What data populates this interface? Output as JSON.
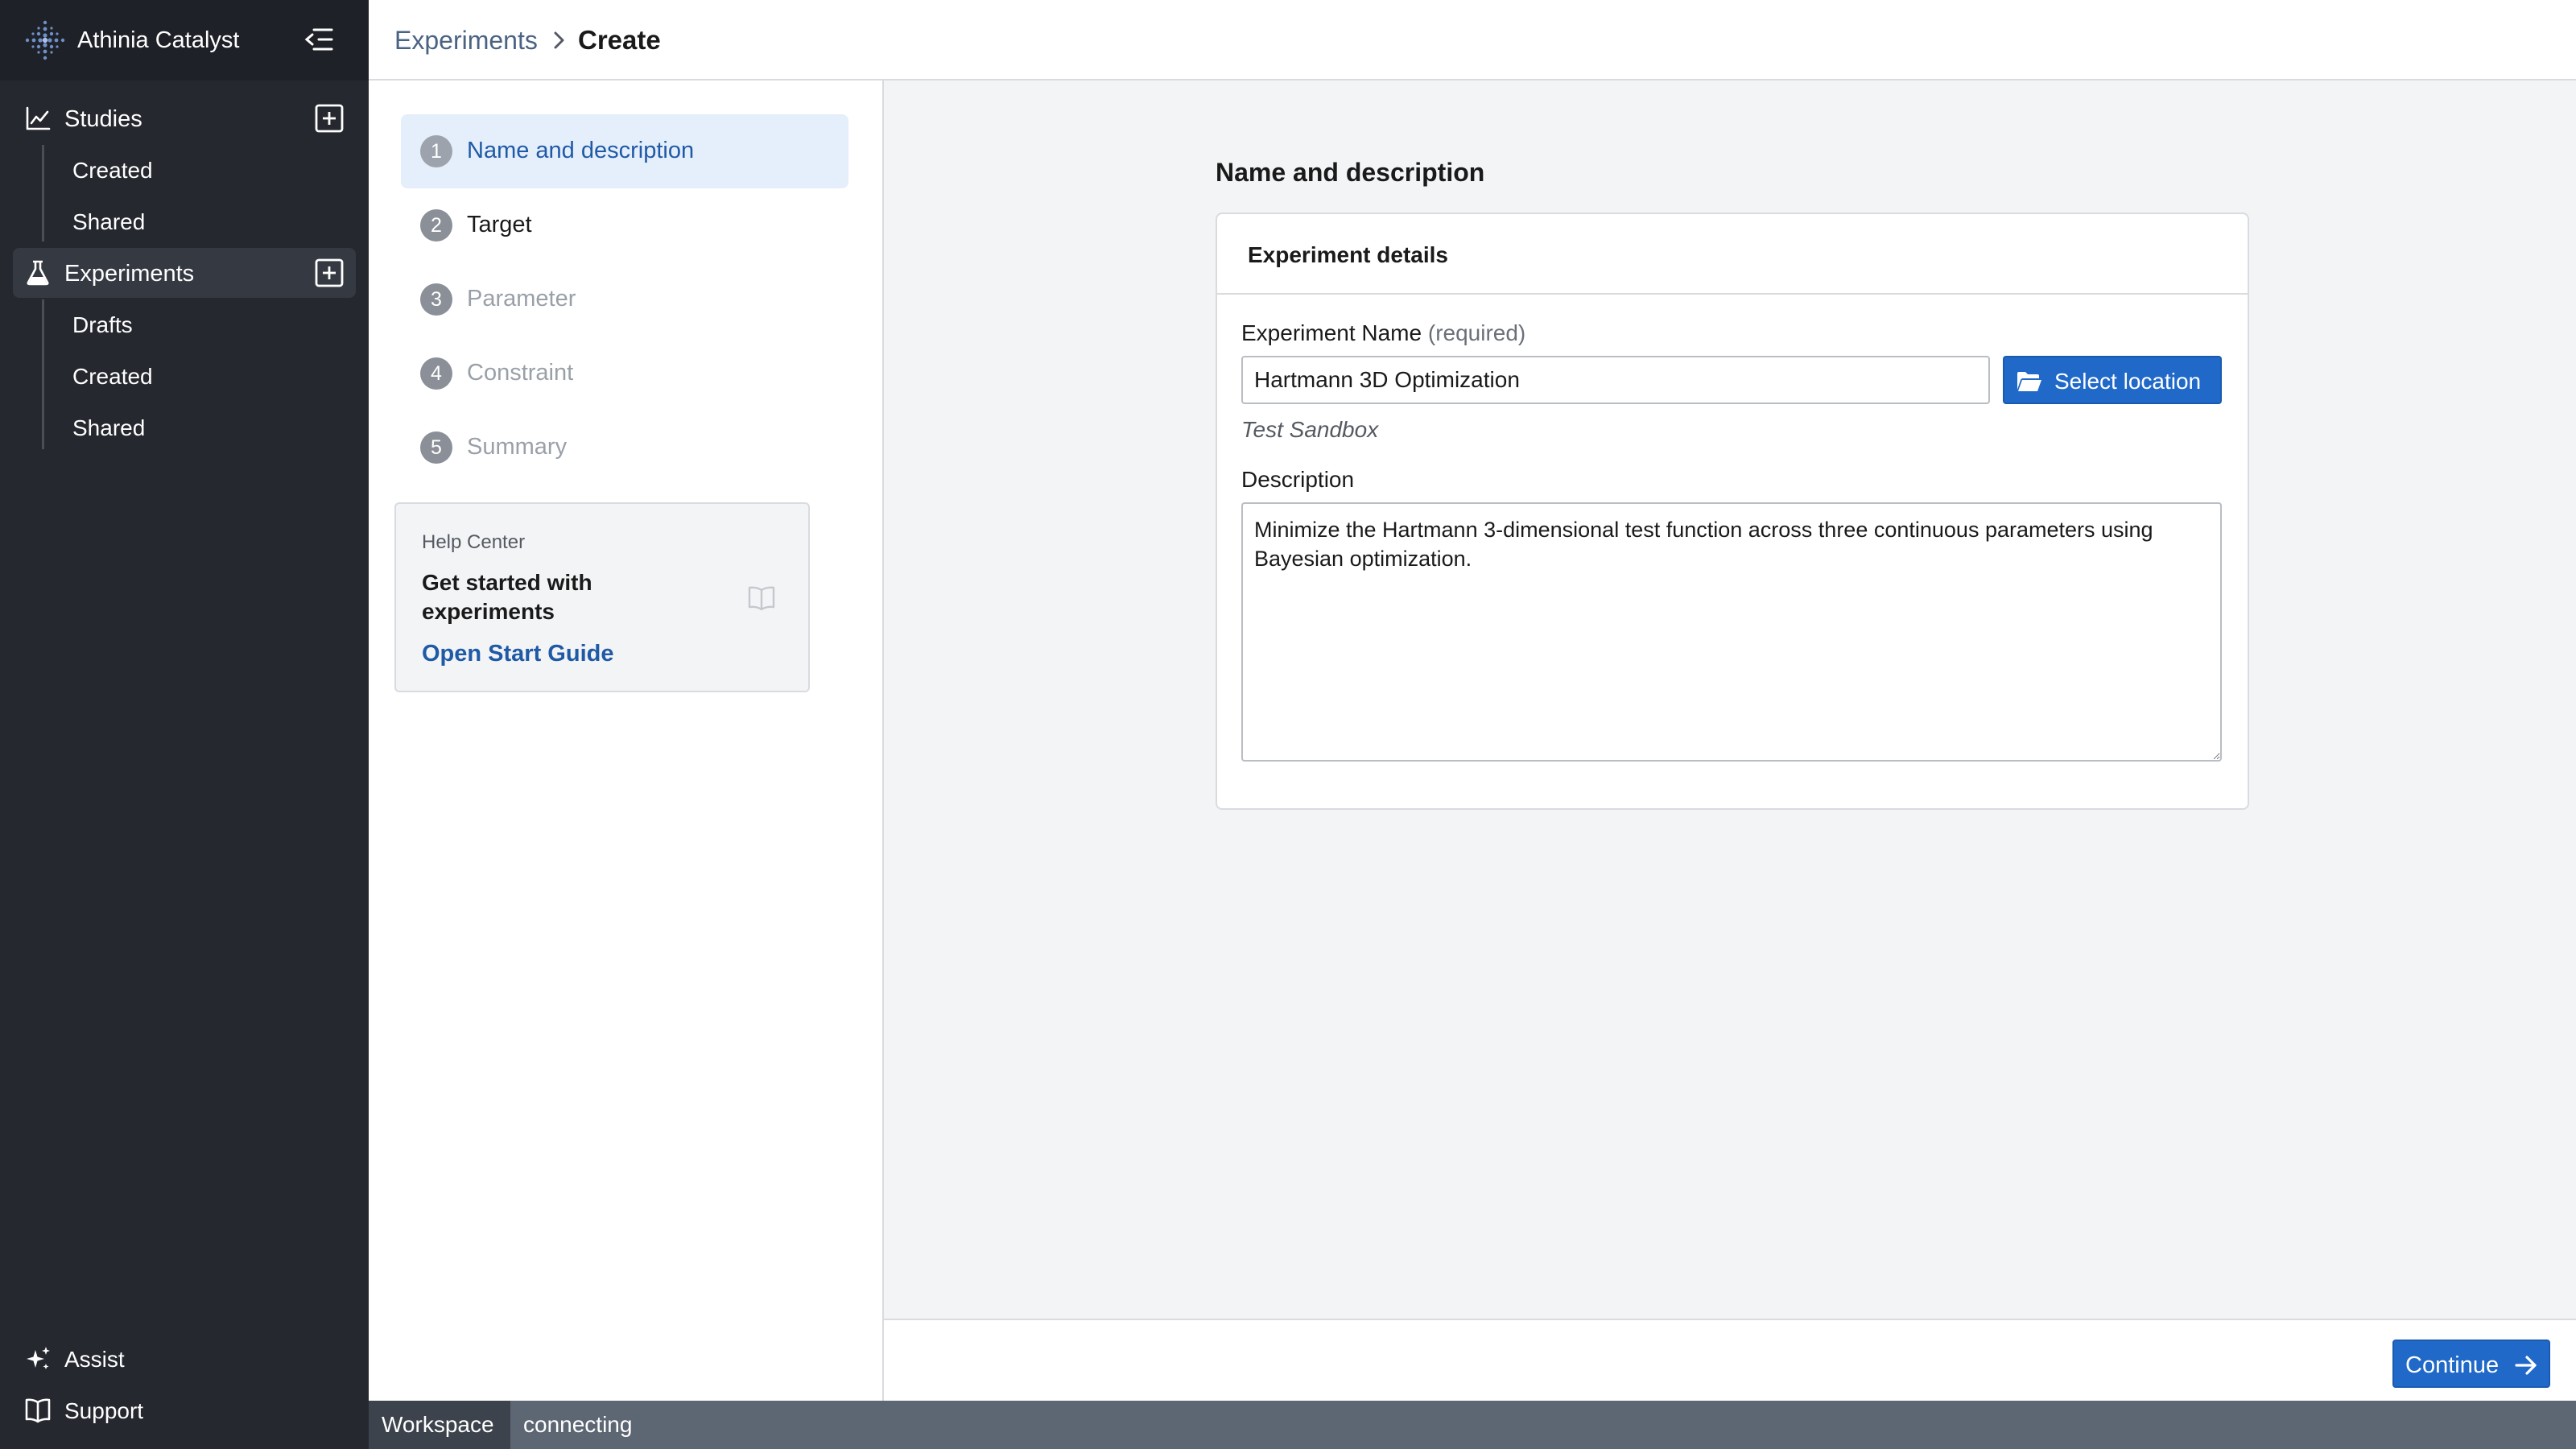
{
  "app": {
    "name": "Athinia Catalyst"
  },
  "sidebar": {
    "sections": [
      {
        "label": "Studies",
        "items": [
          "Created",
          "Shared"
        ]
      },
      {
        "label": "Experiments",
        "items": [
          "Drafts",
          "Created",
          "Shared"
        ]
      }
    ],
    "footer": [
      {
        "label": "Assist",
        "icon": "sparkle-icon"
      },
      {
        "label": "Support",
        "icon": "book-icon"
      }
    ]
  },
  "breadcrumb": {
    "parent": "Experiments",
    "current": "Create"
  },
  "steps": [
    {
      "number": "1",
      "label": "Name and description",
      "state": "active"
    },
    {
      "number": "2",
      "label": "Target",
      "state": "enabled"
    },
    {
      "number": "3",
      "label": "Parameter",
      "state": "disabled"
    },
    {
      "number": "4",
      "label": "Constraint",
      "state": "disabled"
    },
    {
      "number": "5",
      "label": "Summary",
      "state": "disabled"
    }
  ],
  "help": {
    "eyebrow": "Help Center",
    "title": "Get started with experiments",
    "link": "Open Start Guide"
  },
  "form": {
    "section_title": "Name and description",
    "card_title": "Experiment details",
    "name_label": "Experiment Name",
    "name_required": "(required)",
    "name_value": "Hartmann 3D Optimization",
    "select_location_label": "Select location",
    "location": "Test Sandbox",
    "description_label": "Description",
    "description_value": "Minimize the Hartmann 3-dimensional test function across three continuous parameters using Bayesian optimization."
  },
  "actions": {
    "continue_label": "Continue"
  },
  "statusbar": {
    "workspace": "Workspace",
    "status": "connecting"
  },
  "colors": {
    "sidebar_bg": "#25282f",
    "primary": "#2069c8",
    "active_step_bg": "#e5eefb",
    "link": "#1f5aa6"
  }
}
